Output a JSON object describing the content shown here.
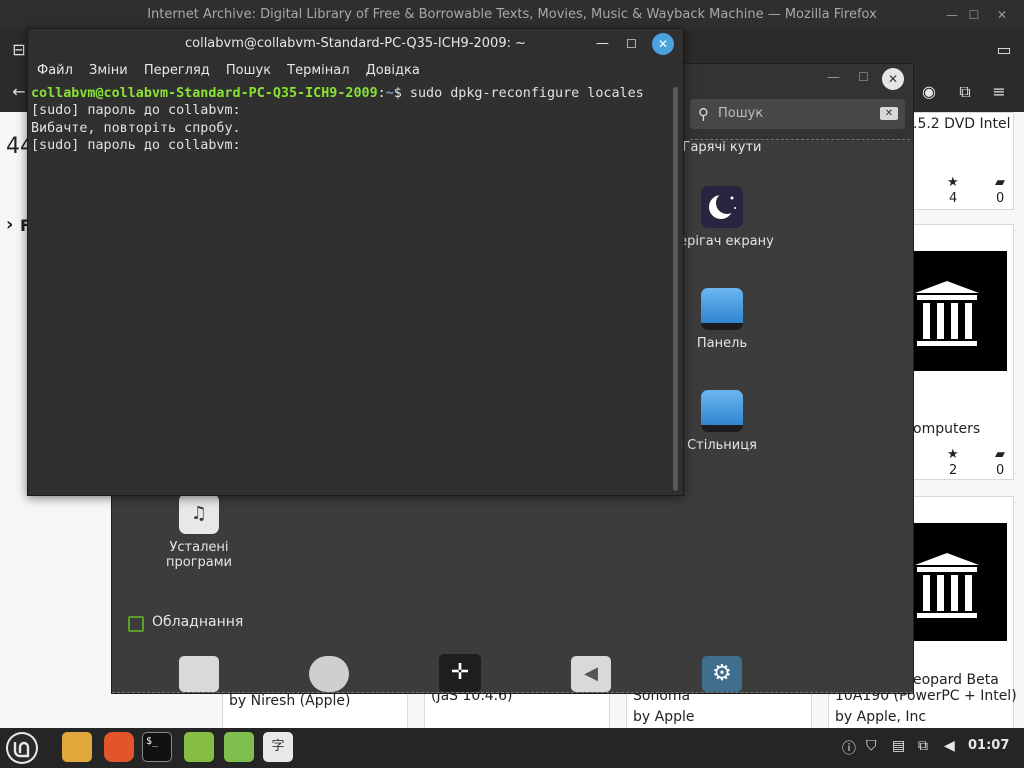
{
  "firefox": {
    "title": "Internet Archive: Digital Library of Free & Borrowable Texts, Movies, Music & Wayback Machine — Mozilla Firefox",
    "left_number": "44",
    "left_marker": "›",
    "left_letter": "F",
    "cards": [
      {
        "title": ".5.2 DVD Intel",
        "favorites": "4",
        "comments": "0"
      },
      {
        "title": "omputers",
        "favorites": "2",
        "comments": "0"
      },
      {
        "title": "eopard Beta",
        "title2": "10A190 (PowerPC + Intel)",
        "by": "by Apple, Inc"
      },
      {
        "by": "by Niresh (Apple)"
      },
      {
        "title": "(JaS 10.4.6)"
      },
      {
        "title": "Sonoma",
        "by": "by Apple"
      }
    ]
  },
  "settings": {
    "search_placeholder": "Пошук",
    "items": {
      "hot_corners": "Гарячі кути",
      "screensaver": "Берігач екрану",
      "panel": "Панель",
      "desktop": "Стільниця",
      "default_apps": "Усталені програми"
    },
    "section_hardware": "Обладнання"
  },
  "terminal": {
    "title": "collabvm@collabvm-Standard-PC-Q35-ICH9-2009: ~",
    "menu": [
      "Файл",
      "Зміни",
      "Перегляд",
      "Пошук",
      "Термінал",
      "Довідка"
    ],
    "prompt_user": "collabvm@collabvm-Standard-PC-Q35-ICH9-2009",
    "prompt_sep": ":",
    "prompt_path": "~",
    "prompt_end": "$ ",
    "command": "sudo dpkg-reconfigure locales",
    "lines": [
      "[sudo] пароль до collabvm:",
      "Вибачте, повторіть спробу.",
      "[sudo] пароль до collabvm:"
    ]
  },
  "taskbar": {
    "clock": "01:07"
  }
}
